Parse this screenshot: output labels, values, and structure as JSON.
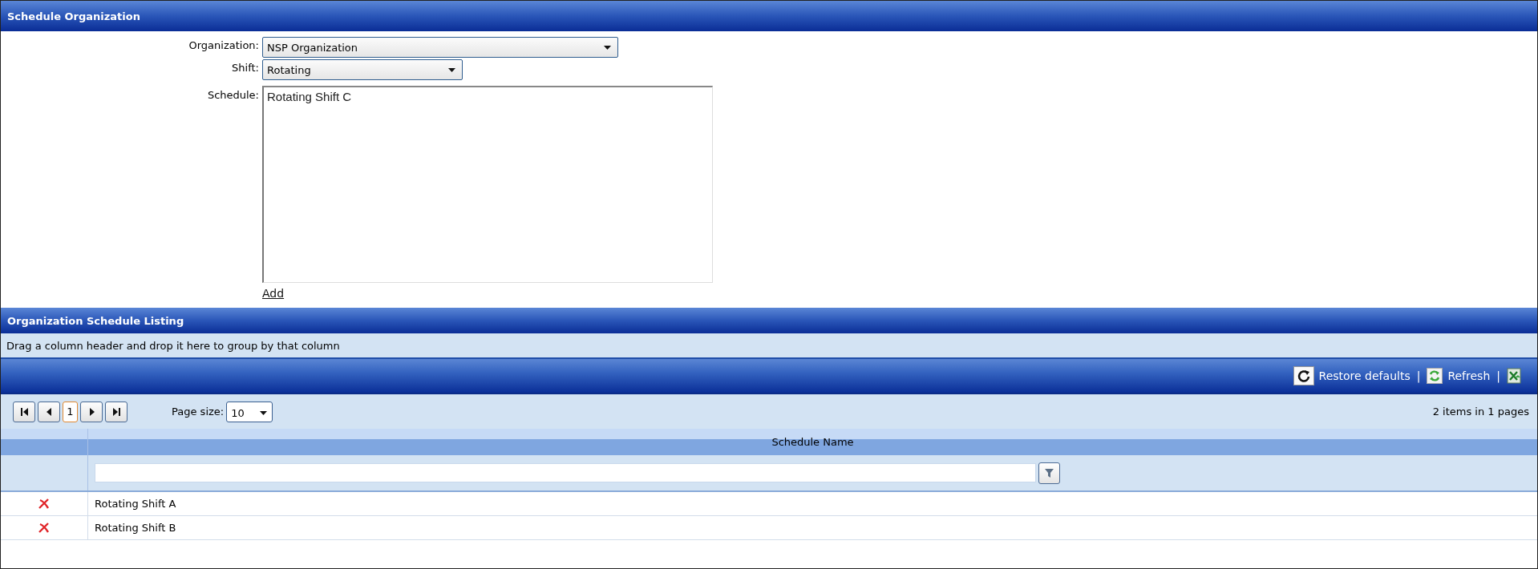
{
  "schedule_organization": {
    "title": "Schedule Organization",
    "fields": [
      {
        "kind": "dropdown",
        "label": "Organization:",
        "value": "NSP Organization"
      },
      {
        "kind": "dropdown",
        "label": "Shift:",
        "value": "Rotating"
      },
      {
        "kind": "textarea",
        "label": "Schedule:",
        "value": "Rotating Shift C"
      }
    ],
    "add_link": "Add"
  },
  "listing": {
    "title": "Organization Schedule Listing",
    "group_hint": "Drag a column header and drop it here to group by that column",
    "toolbar": [
      {
        "kind": "restore",
        "label": "Restore defaults"
      },
      {
        "kind": "separator",
        "label": "|"
      },
      {
        "kind": "refresh",
        "label": "Refresh"
      },
      {
        "kind": "separator",
        "label": "|"
      },
      {
        "kind": "export"
      }
    ],
    "pager": {
      "pages": [
        {
          "label": "1",
          "selected": true
        }
      ],
      "page_size_label": "Page size:",
      "page_size": "10",
      "summary": "2 items in 1 pages"
    },
    "columns": [
      "Schedule Name"
    ],
    "rows": [
      {
        "name": "Rotating Shift A"
      },
      {
        "name": "Rotating Shift B"
      }
    ]
  }
}
